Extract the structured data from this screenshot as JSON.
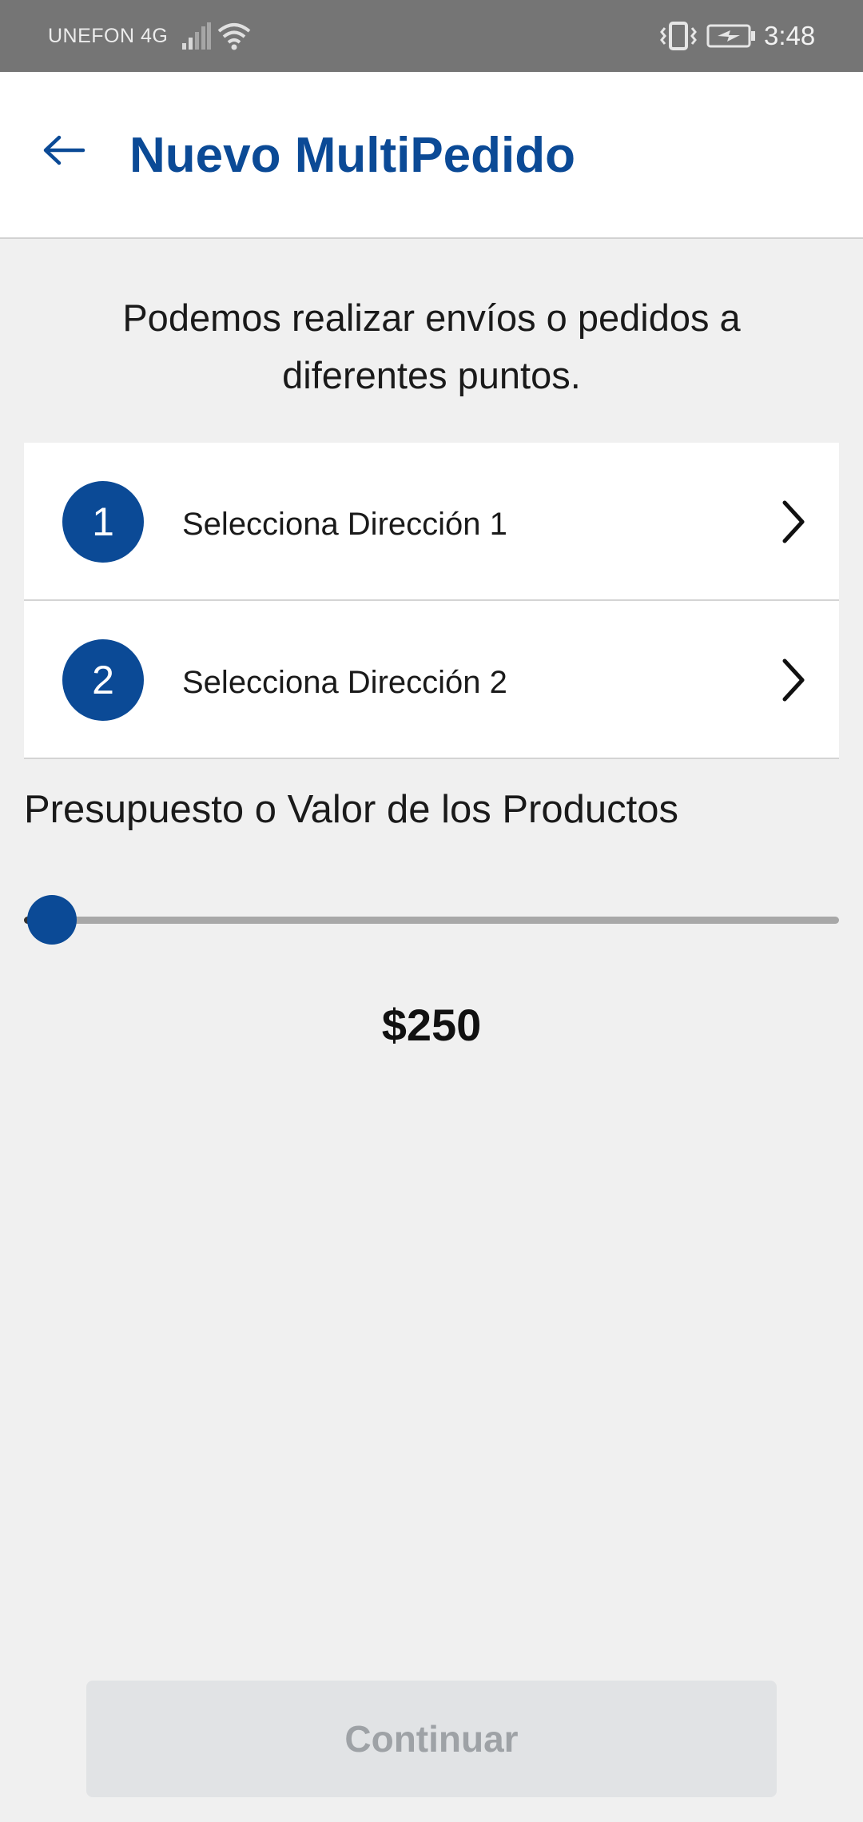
{
  "status_bar": {
    "carrier": "UNEFON 4G",
    "time": "3:48",
    "icons": [
      "signal-icon",
      "wifi-icon",
      "vibrate-icon",
      "battery-charging-icon"
    ]
  },
  "header": {
    "back_icon": "arrow-left-icon",
    "title": "Nuevo MultiPedido"
  },
  "intro": {
    "line1": "Podemos realizar envíos o pedidos a",
    "line2": "diferentes puntos."
  },
  "addresses": [
    {
      "number": "1",
      "label": "Selecciona Dirección 1",
      "icon": "chevron-right-icon"
    },
    {
      "number": "2",
      "label": "Selecciona Dirección 2",
      "icon": "chevron-right-icon"
    }
  ],
  "budget": {
    "label": "Presupuesto o Valor de los Productos",
    "value": "$250",
    "slider_fraction": 0.0
  },
  "footer": {
    "continue_label": "Continuar",
    "continue_enabled": false
  },
  "colors": {
    "primary": "#0b4a96",
    "status_bar": "#757575",
    "background": "#f0f0f0",
    "disabled_button_bg": "#e1e3e5",
    "disabled_button_text": "#9ea2a6"
  }
}
